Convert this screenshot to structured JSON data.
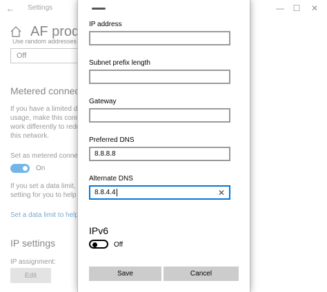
{
  "window": {
    "title": "Settings",
    "back_glyph": "←",
    "minimize_glyph": "—",
    "maximize_glyph": "☐",
    "close_glyph": "✕"
  },
  "background": {
    "page_title": "AF produ",
    "cut_text": "Use random addresses",
    "dropdown_value": "Off",
    "metered_heading": "Metered connectio",
    "metered_desc": [
      "If you have a limited da",
      "usage, make this conne",
      "work differently to redu",
      "this network."
    ],
    "metered_toggle_label": "Set as metered connec",
    "metered_toggle_state": "On",
    "data_limit_desc": [
      "If you set a data limit, W",
      "setting for you to help"
    ],
    "data_limit_link": "Set a data limit to help",
    "ip_heading": "IP settings",
    "ip_assignment_label": "IP assignment:",
    "edit_button": "Edit"
  },
  "dialog": {
    "fields": [
      {
        "label": "IP address",
        "value": ""
      },
      {
        "label": "Subnet prefix length",
        "value": ""
      },
      {
        "label": "Gateway",
        "value": ""
      },
      {
        "label": "Preferred DNS",
        "value": "8.8.8.8"
      },
      {
        "label": "Alternate DNS",
        "value": "8.8.4.4"
      }
    ],
    "clear_glyph": "✕",
    "ipv6_heading": "IPv6",
    "ipv6_toggle_state": "Off",
    "save_label": "Save",
    "cancel_label": "Cancel"
  },
  "colors": {
    "accent": "#0078d7",
    "button_bg": "#cccccc",
    "link": "#0063b1"
  }
}
